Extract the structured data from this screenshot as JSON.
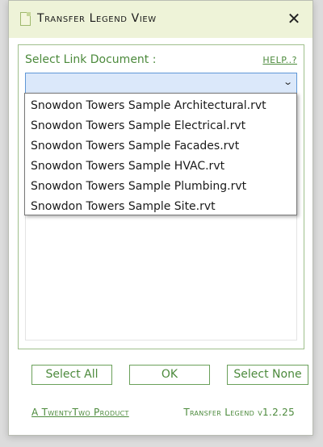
{
  "window": {
    "title": "Transfer Legend View",
    "close_symbol": "✕"
  },
  "panel": {
    "select_label": "Select Link Document :",
    "help_link": "HELP..?",
    "combo_value": "",
    "dropdown_icon": "chevron-down-icon",
    "dropdown_items": [
      "Snowdon Towers Sample Architectural.rvt",
      "Snowdon Towers Sample Electrical.rvt",
      "Snowdon Towers Sample Facades.rvt",
      "Snowdon Towers Sample HVAC.rvt",
      "Snowdon Towers Sample Plumbing.rvt",
      "Snowdon Towers Sample Site.rvt"
    ]
  },
  "buttons": {
    "select_all": "Select All",
    "ok": "OK",
    "select_none": "Select None"
  },
  "footer": {
    "product_link": "A TwentyTwo Product",
    "version": "Transfer Legend v1.2.25"
  },
  "colors": {
    "accent_green": "#4c8a3c",
    "titlebar_bg": "#eef3d8",
    "combo_bg": "#dbe8fa",
    "combo_border": "#5f97d6"
  }
}
